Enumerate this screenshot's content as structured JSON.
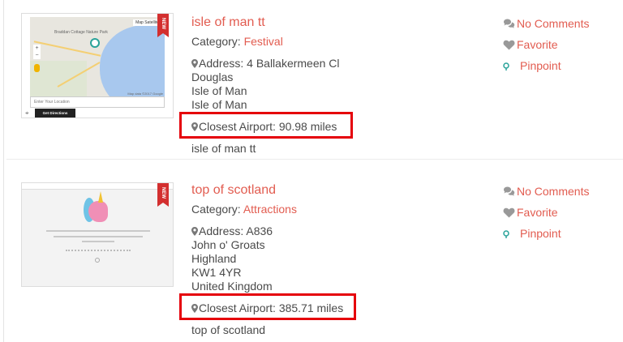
{
  "listings": [
    {
      "badge": "NEW",
      "title": "isle of man tt",
      "category_label": "Category: ",
      "category": "Festival",
      "address_lines": [
        "Address: 4 Ballakermeen Cl",
        "Douglas",
        "Isle of Man",
        "Isle of Man"
      ],
      "closest_airport": "Closest Airport: 90.98 miles",
      "excerpt": "isle of man tt",
      "thumbnail": {
        "map_tabs": "Map  Satellite",
        "place_label": "Braddan Cottage Nature Park",
        "location_placeholder": "Enter Your Location",
        "directions_button": "Get Directions",
        "map_credit": "Map data ©2017 Google"
      },
      "actions": {
        "comments": "No Comments",
        "favorite": "Favorite",
        "pinpoint": "Pinpoint"
      }
    },
    {
      "badge": "NEW",
      "title": "top of scotland",
      "category_label": "Category: ",
      "category": "Attractions",
      "address_lines": [
        "Address: A836",
        "John o' Groats",
        "Highland",
        "KW1 4YR",
        "United Kingdom"
      ],
      "closest_airport": "Closest Airport: 385.71 miles",
      "excerpt": "top of scotland",
      "actions": {
        "comments": "No Comments",
        "favorite": "Favorite",
        "pinpoint": "Pinpoint"
      }
    }
  ],
  "colors": {
    "accent": "#e25c50",
    "highlight_box": "#e5000a",
    "pin_teal": "#2aa39a",
    "icon_gray": "#8a8a8a"
  }
}
